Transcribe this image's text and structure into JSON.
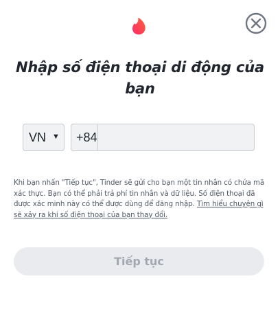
{
  "logo": {
    "icon": "flame-icon",
    "colors": [
      "#fd2b6c",
      "#ff6036"
    ]
  },
  "close": {
    "icon": "close-icon"
  },
  "title": "Nhập số điện thoại di động của bạn",
  "phone": {
    "country": "VN",
    "dial_code": "+84",
    "value": "",
    "placeholder": ""
  },
  "disclaimer": {
    "text": "Khi bạn nhấn \"Tiếp tục\", Tinder sẽ gửi cho bạn một tin nhắn có chứa mã xác thực. Bạn có thể phải trả phí tin nhắn và dữ liệu. Số điện thoại đã được xác minh này có thể được dùng để đăng nhập. ",
    "link": "Tìm hiểu chuyện gì sẽ xảy ra khi số điện thoại của bạn thay đổi."
  },
  "continue_button": "Tiếp tục"
}
